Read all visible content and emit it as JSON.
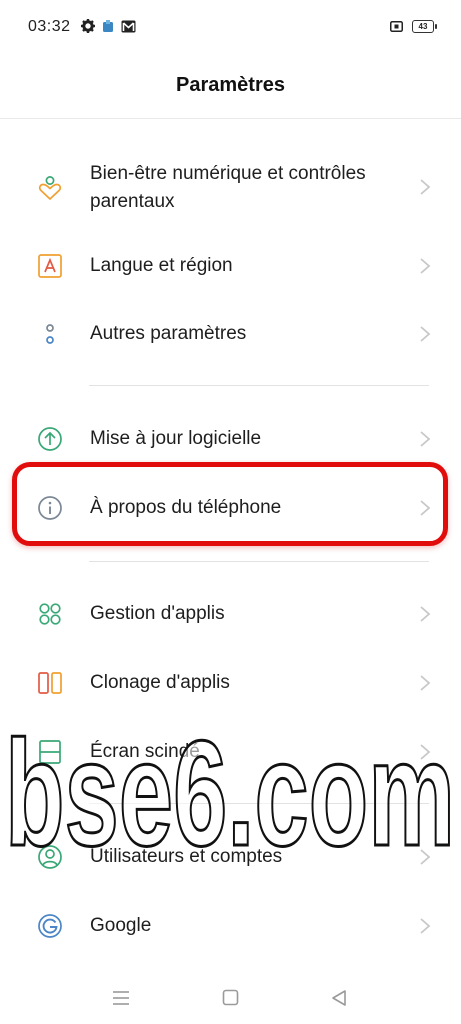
{
  "status_bar": {
    "time": "03:32",
    "left_icons": [
      "gear-icon",
      "app-notification-icon",
      "gmail-icon"
    ],
    "right_icons": [
      "screenshot-icon",
      "battery-icon"
    ],
    "battery_level": "43"
  },
  "header": {
    "title": "Paramètres"
  },
  "settings": {
    "items": [
      {
        "label": "Bien-être numérique et contrôles parentaux",
        "icon": "heart-person-icon"
      },
      {
        "label": "Langue et région",
        "icon": "language-icon"
      },
      {
        "label": "Autres paramètres",
        "icon": "more-settings-icon"
      },
      {
        "label": "Mise à jour logicielle",
        "icon": "update-arrow-icon"
      },
      {
        "label": "À propos du téléphone",
        "icon": "info-icon"
      },
      {
        "label": "Gestion d'applis",
        "icon": "apps-grid-icon"
      },
      {
        "label": "Clonage d'applis",
        "icon": "clone-icon"
      },
      {
        "label": "Écran scindé",
        "icon": "split-screen-icon"
      },
      {
        "label": "Utilisateurs et comptes",
        "icon": "users-icon"
      },
      {
        "label": "Google",
        "icon": "google-icon"
      }
    ],
    "highlighted_item": "À propos du téléphone"
  },
  "watermark": {
    "text": "bse6.com"
  },
  "nav_bar": {
    "buttons": [
      "menu-icon",
      "home-icon",
      "back-icon"
    ]
  },
  "colors": {
    "highlight_border": "#e10d0d",
    "icon_green": "#3aa876",
    "icon_orange": "#f0a030",
    "icon_gray": "#7a8796"
  }
}
